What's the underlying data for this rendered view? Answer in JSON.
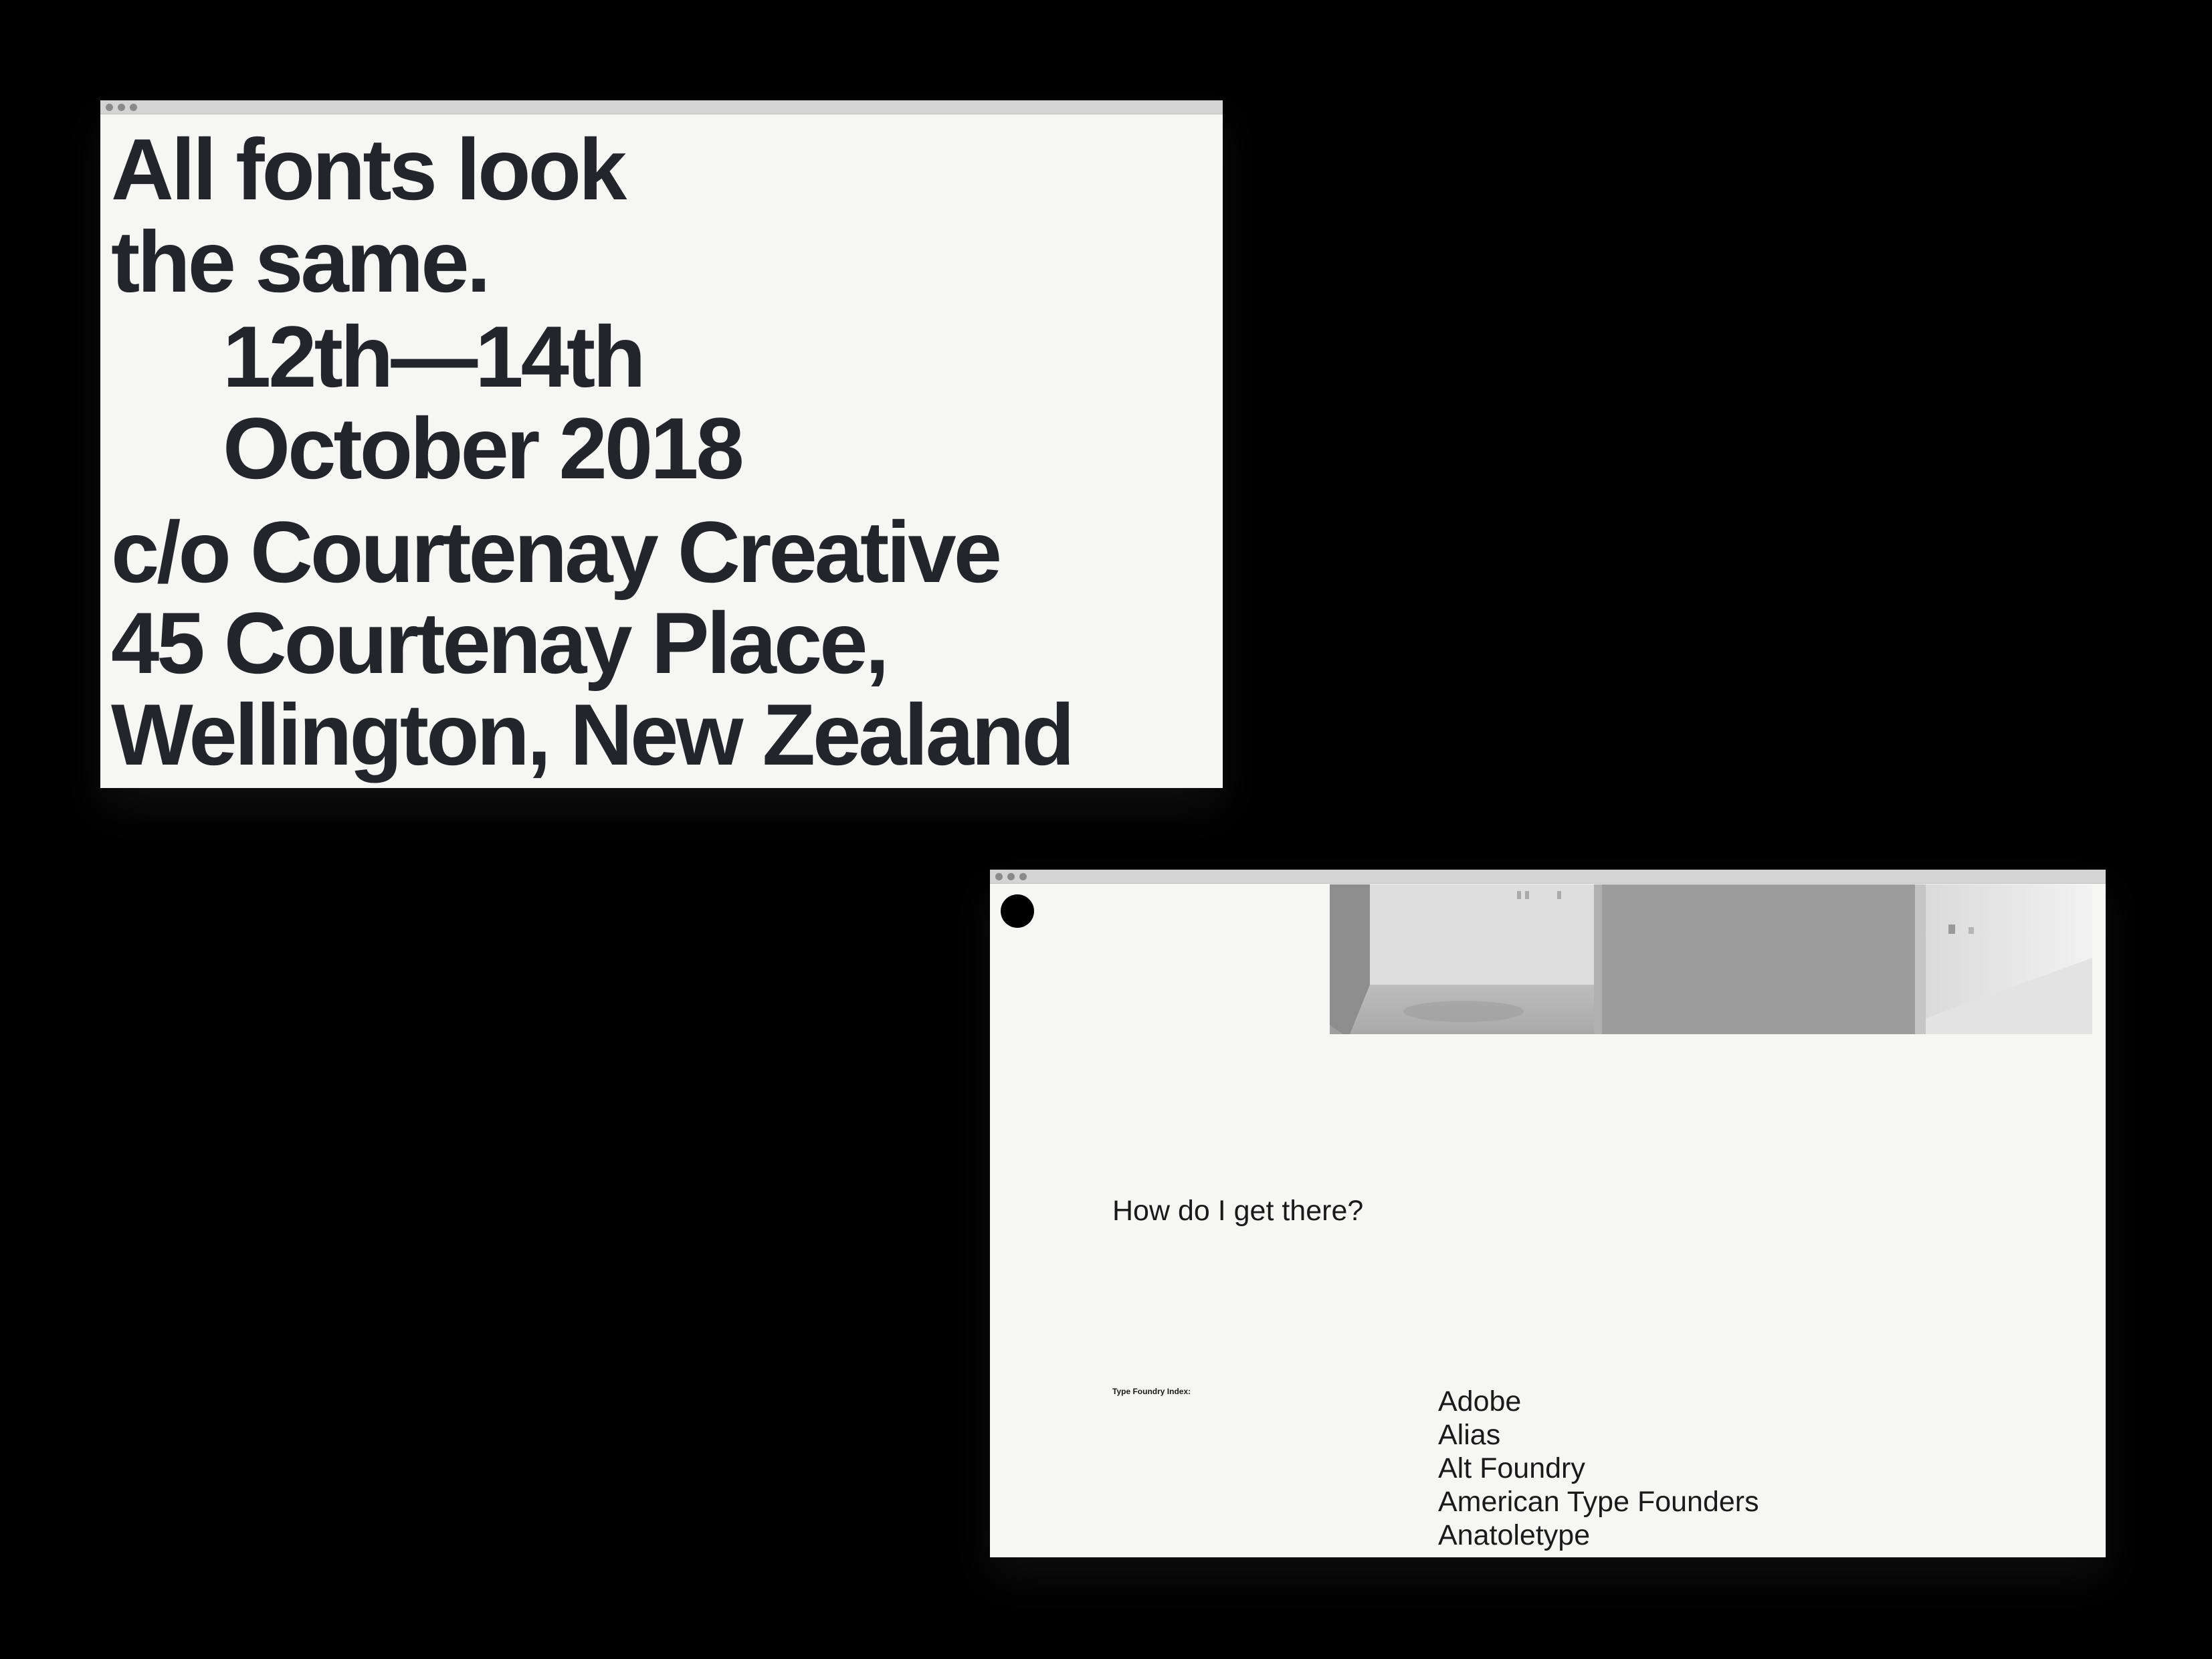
{
  "window1": {
    "headline": [
      "All fonts look",
      "the same."
    ],
    "date": [
      "12th—14th",
      "October 2018"
    ],
    "venue": [
      "c/o Courtenay Creative",
      "45 Courtenay Place,",
      "Wellington, New Zealand"
    ]
  },
  "window2": {
    "question": "How do I get there?",
    "index_label": "Type Foundry Index:",
    "foundries": [
      "Adobe",
      "Alias",
      "Alt Foundry",
      "American Type Founders",
      "Anatoletype"
    ]
  },
  "colors": {
    "page_background": "#000000",
    "window_background": "#f6f7f5",
    "text": "#23252b",
    "titlebar": "#d4d4d4"
  },
  "icons": {
    "window_controls": "traffic-light-dots",
    "logo": "filled-circle"
  }
}
